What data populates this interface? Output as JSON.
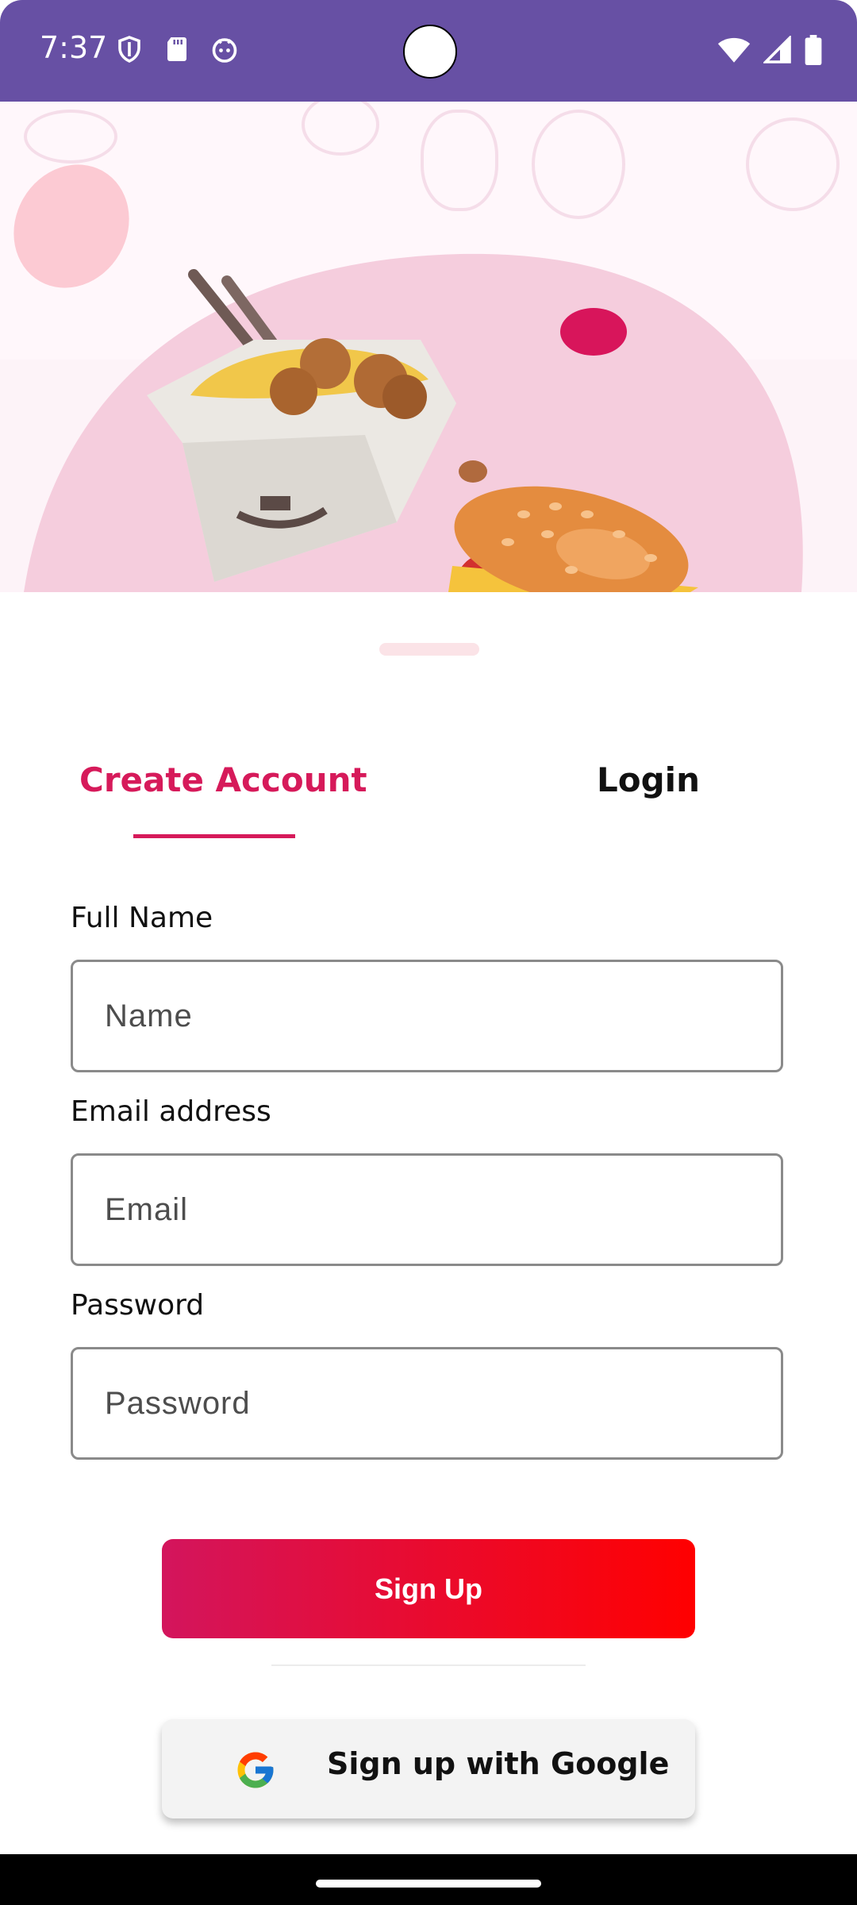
{
  "status_bar": {
    "time": "7:37",
    "left_icons": [
      "shield-icon",
      "sd-card-icon",
      "robot-face-icon"
    ],
    "right_icons": [
      "wifi-icon",
      "signal-icon",
      "battery-icon"
    ],
    "background_color": "#6750a4"
  },
  "hero": {
    "illustration": "noodle-box-and-burger-illustration"
  },
  "tabs": {
    "create_account": "Create Account",
    "login": "Login",
    "active": "create_account",
    "active_color": "#d61a5a"
  },
  "form": {
    "full_name": {
      "label": "Full Name",
      "placeholder": "Name"
    },
    "email": {
      "label": "Email address",
      "placeholder": "Email"
    },
    "password": {
      "label": "Password",
      "placeholder": "Password"
    }
  },
  "actions": {
    "sign_up": "Sign Up",
    "google_sign_up": "Sign up with Google",
    "gradient_start": "#d3155d",
    "gradient_end": "#ff0000"
  }
}
